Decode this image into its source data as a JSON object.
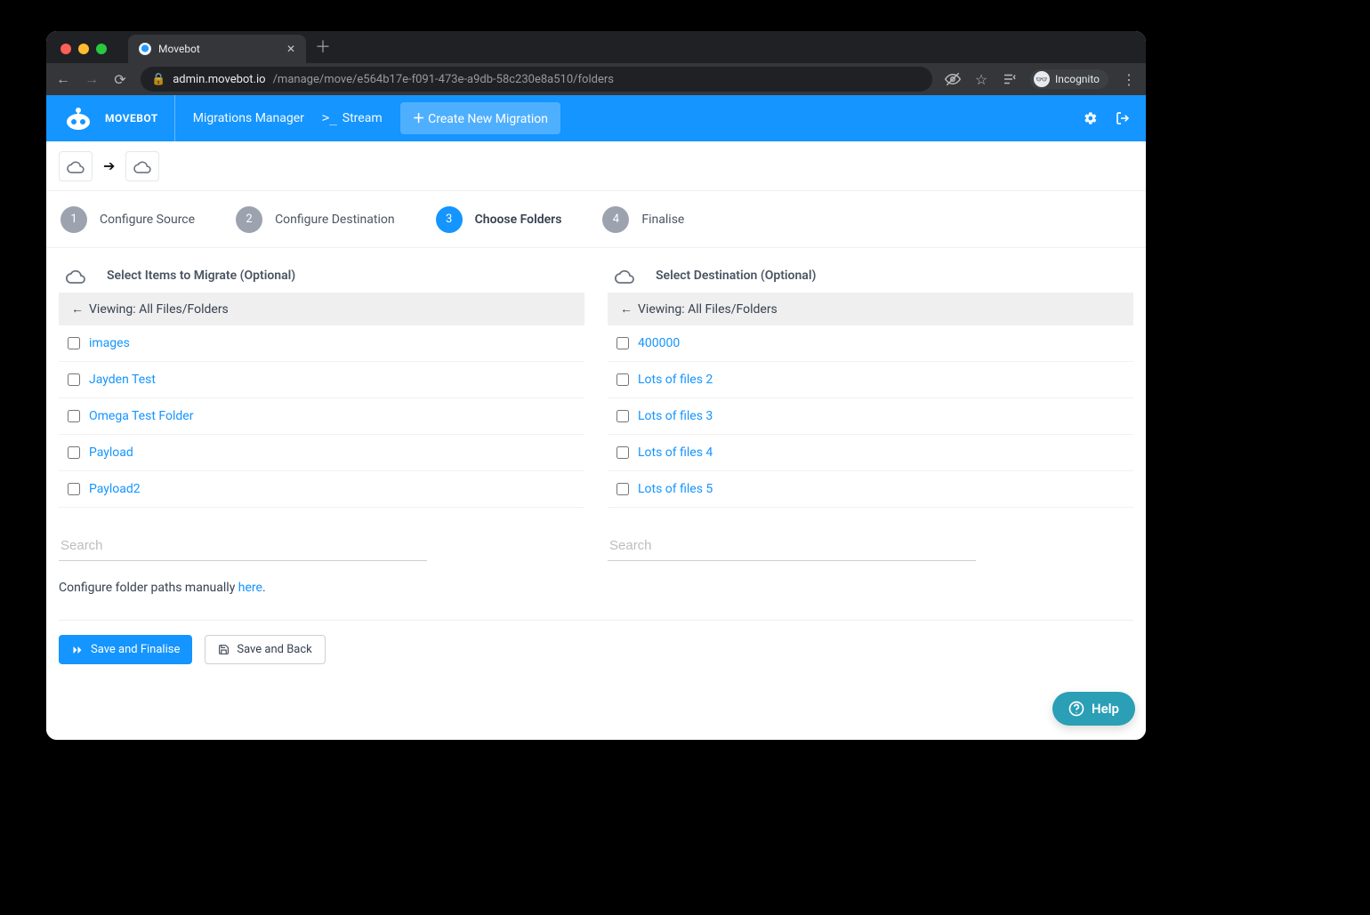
{
  "browser": {
    "tab_title": "Movebot",
    "url_host": "admin.movebot.io",
    "url_path": "/manage/move/e564b17e-f091-473e-a9db-58c230e8a510/folders",
    "incognito_label": "Incognito"
  },
  "nav": {
    "brand": "MOVEBOT",
    "links": {
      "migrations": "Migrations Manager",
      "stream": "Stream"
    },
    "create_migration": "Create New Migration"
  },
  "stepper": [
    {
      "num": "1",
      "label": "Configure Source",
      "active": false
    },
    {
      "num": "2",
      "label": "Configure Destination",
      "active": false
    },
    {
      "num": "3",
      "label": "Choose Folders",
      "active": true
    },
    {
      "num": "4",
      "label": "Finalise",
      "active": false
    }
  ],
  "source_pane": {
    "title": "Select Items to Migrate (Optional)",
    "viewing_prefix": "Viewing: ",
    "viewing_path": "All Files/Folders",
    "items": [
      "images",
      "Jayden Test",
      "Omega Test Folder",
      "Payload",
      "Payload2"
    ],
    "search_placeholder": "Search"
  },
  "dest_pane": {
    "title": "Select Destination (Optional)",
    "viewing_prefix": "Viewing: ",
    "viewing_path": "All Files/Folders",
    "items": [
      "400000",
      "Lots of files 2",
      "Lots of files 3",
      "Lots of files 4",
      "Lots of files 5"
    ],
    "search_placeholder": "Search"
  },
  "manual": {
    "text": "Configure folder paths manually ",
    "link": "here",
    "suffix": "."
  },
  "buttons": {
    "save_finalise": "Save and Finalise",
    "save_back": "Save and Back"
  },
  "help": {
    "label": "Help"
  }
}
